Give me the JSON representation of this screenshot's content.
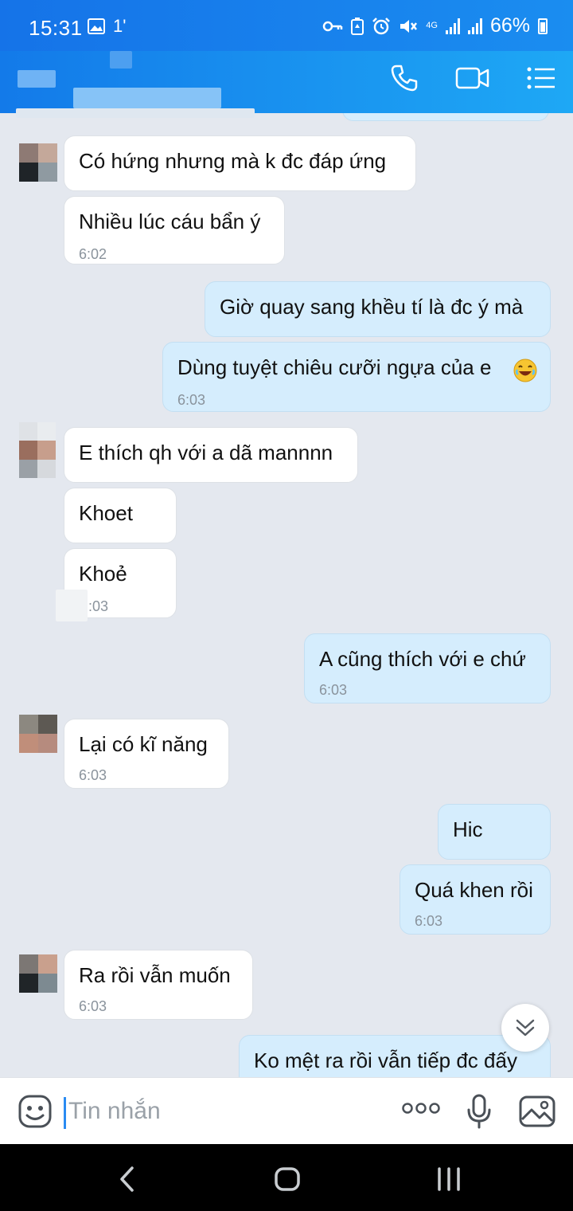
{
  "status_bar": {
    "time": "15:31",
    "notif": "1'",
    "network": "4G",
    "battery": "66%"
  },
  "composer": {
    "placeholder": "Tin nhắn"
  },
  "messages": [
    {
      "dir": "in",
      "text": "Có hứng nhưng mà k đc đáp ứng"
    },
    {
      "dir": "in",
      "text": "Nhiều lúc cáu bẩn ý",
      "time": "6:02"
    },
    {
      "dir": "out",
      "text": "Giờ quay sang khều tí là đc ý mà"
    },
    {
      "dir": "out",
      "text": "Dùng tuyệt chiêu cưỡi ngựa của e",
      "time": "6:03",
      "emoji": "laughing-emoji"
    },
    {
      "dir": "in",
      "text": "E thích qh với a dã mannnn"
    },
    {
      "dir": "in",
      "text": "Khoet"
    },
    {
      "dir": "in",
      "text": "Khoẻ",
      "time": ":03"
    },
    {
      "dir": "out",
      "text": "A cũng thích với e chứ",
      "time": "6:03"
    },
    {
      "dir": "in",
      "text": "Lại có kĩ năng",
      "time": "6:03"
    },
    {
      "dir": "out",
      "text": "Hic"
    },
    {
      "dir": "out",
      "text": "Quá khen rồi",
      "time": "6:03"
    },
    {
      "dir": "in",
      "text": "Ra rồi vẫn muốn",
      "time": "6:03"
    },
    {
      "dir": "out",
      "text": "Ko mệt ra rồi vẫn tiếp đc đấy"
    }
  ],
  "icons": [
    "phone-icon",
    "video-call-icon",
    "menu-icon",
    "emoji-icon",
    "more-icon",
    "mic-icon",
    "gallery-icon",
    "scroll-down-icon",
    "back-nav-icon",
    "home-nav-icon",
    "recents-nav-icon"
  ],
  "colors": {
    "header": "#1a8df0",
    "incoming_bubble": "#ffffff",
    "outgoing_bubble": "#d5edfd",
    "chat_background": "#e4e8ef",
    "caret": "#2a8bf2"
  }
}
